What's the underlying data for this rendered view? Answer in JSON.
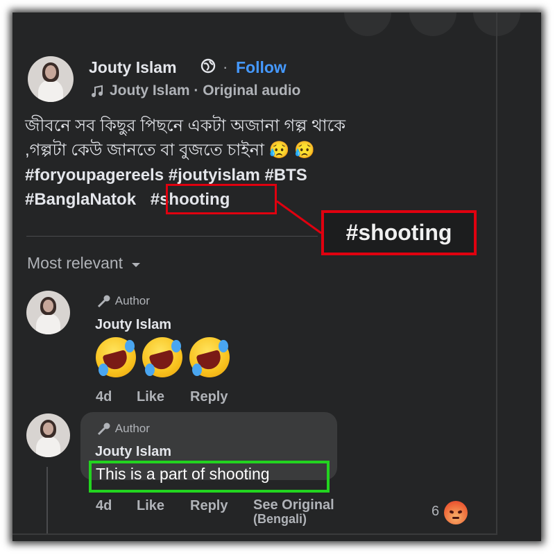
{
  "post": {
    "author": "Jouty Islam",
    "separator": "·",
    "follow_label": "Follow",
    "audio_line": "Jouty Islam · Original audio",
    "text_line1": "জীবনে সব কিছুর পিছনে একটা অজানা গল্প থাকে",
    "text_line2": ",গল্পটা কেউ জানতে বা বুজতে চাইনা 😥 😥",
    "hashtags_line1": "#foryoupagereels #joutyislam  #BTS",
    "hashtags_line2_a": "#BanglaNatok",
    "hashtags_line2_b": "#shooting"
  },
  "callout": {
    "text": "#shooting"
  },
  "comments": {
    "sort_label": "Most relevant",
    "items": [
      {
        "badge": "Author",
        "name": "Jouty Islam",
        "time": "4d",
        "like": "Like",
        "reply": "Reply"
      },
      {
        "badge": "Author",
        "name": "Jouty Islam",
        "text": "This is a part of shooting",
        "time": "4d",
        "like": "Like",
        "reply": "Reply",
        "see_original_line1": "See Original",
        "see_original_line2": "(Bengali)",
        "reaction_count": "6"
      }
    ]
  },
  "icons": {
    "globe": "globe-icon",
    "music": "music-note-icon",
    "author_badge": "microphone-icon",
    "sort": "chevron-down-icon",
    "emoji": "rolling-on-floor-laughing-emoji",
    "reaction": "angry-reaction-icon"
  },
  "colors": {
    "background": "#242526",
    "follow": "#4599ff",
    "highlight_red": "#e0000f",
    "highlight_green": "#22d41f"
  }
}
